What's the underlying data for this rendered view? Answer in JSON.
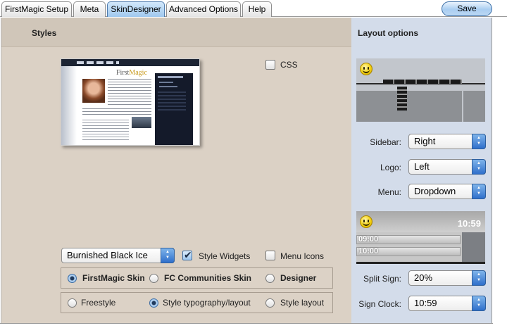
{
  "tabs": [
    {
      "label": "FirstMagic Setup",
      "active": false
    },
    {
      "label": "Meta",
      "active": false
    },
    {
      "label": "SkinDesigner",
      "active": true
    },
    {
      "label": "Advanced Options",
      "active": false
    },
    {
      "label": "Help",
      "active": false
    }
  ],
  "toolbar": {
    "save_label": "Save"
  },
  "styles": {
    "title": "Styles",
    "css_label": "CSS",
    "css_checked": false,
    "thumbnail": {
      "logo_first": "First",
      "logo_magic": "Magic"
    },
    "skin_select": "Burnished Black Ice",
    "style_widgets_label": "Style Widgets",
    "style_widgets_checked": true,
    "menu_icons_label": "Menu Icons",
    "menu_icons_checked": false,
    "skin_options": [
      {
        "label": "FirstMagic Skin",
        "selected": true
      },
      {
        "label": "FC Communities Skin",
        "selected": false
      },
      {
        "label": "Designer",
        "selected": false
      }
    ],
    "mode_options": [
      {
        "label": "Freestyle",
        "selected": false
      },
      {
        "label": "Style typography/layout",
        "selected": true
      },
      {
        "label": "Style layout",
        "selected": false
      }
    ]
  },
  "layout": {
    "title": "Layout options",
    "sidebar_label": "Sidebar:",
    "sidebar_value": "Right",
    "logo_label": "Logo:",
    "logo_value": "Left",
    "menu_label": "Menu:",
    "menu_value": "Dropdown",
    "preview_clock": "10:59",
    "preview_signs": [
      "09:00",
      "10:00"
    ],
    "split_sign_label": "Split Sign:",
    "split_sign_value": "20%",
    "sign_clock_label": "Sign Clock:",
    "sign_clock_value": "10:59"
  },
  "colors": {
    "main_bg": "#dbd1c5",
    "side_bg": "#d3dcea",
    "active_tab": "#9fc8ee",
    "accent_blue": "#2f6fcb"
  },
  "icons": [
    "smiley-icon",
    "checkmark-icon",
    "select-arrows-icon"
  ]
}
